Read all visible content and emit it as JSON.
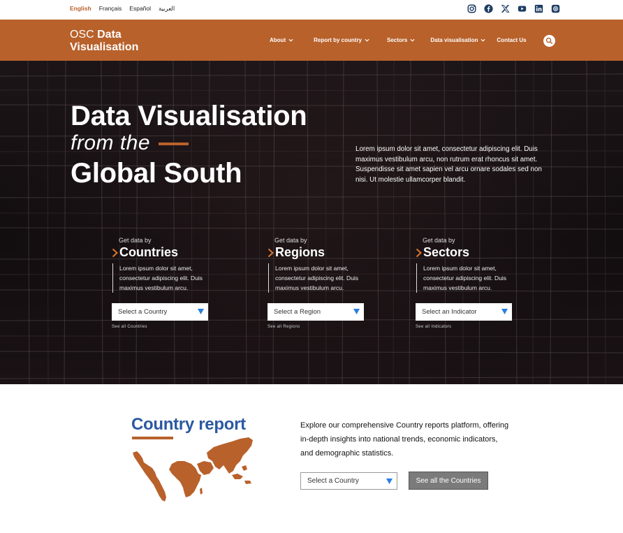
{
  "languages": [
    {
      "label": "English",
      "active": true
    },
    {
      "label": "Français",
      "active": false
    },
    {
      "label": "Español",
      "active": false
    },
    {
      "label": "العربية",
      "active": false
    }
  ],
  "socials": [
    "instagram-icon",
    "facebook-icon",
    "x-icon",
    "youtube-icon",
    "linkedin-icon",
    "threads-icon"
  ],
  "logo": {
    "light": "OSC ",
    "bold1": "Data",
    "bold2": "Visualisation"
  },
  "nav": {
    "about": "About",
    "report_by_country": "Report by country",
    "sectors": "Sectors",
    "data_visualisation": "Data visualisation",
    "contact": "Contact Us"
  },
  "hero": {
    "title_line1": "Data Visualisation",
    "title_line2": "from the",
    "title_line3": "Global South",
    "description": "Lorem ipsum dolor sit amet, consectetur adipiscing elit. Duis maximus vestibulum arcu, non rutrum erat rhoncus sit amet. Suspendisse sit amet sapien vel arcu ornare sodales sed non nisi. Ut molestie ullamcorper blandit."
  },
  "columns": [
    {
      "pre": "Get data by",
      "title": "Countries",
      "desc": "Lorem ipsum dolor sit amet, consectetur adipiscing elit. Duis maximus vestibulum arcu.",
      "select": "Select a Country",
      "see_all": "See all Countries"
    },
    {
      "pre": "Get data by",
      "title": "Regions",
      "desc": "Lorem ipsum dolor sit amet, consectetur adipiscing elit. Duis maximus vestibulum arcu.",
      "select": "Select a Region",
      "see_all": "See all Regions"
    },
    {
      "pre": "Get data by",
      "title": "Sectors",
      "desc": "Lorem ipsum dolor sit amet, consectetur adipiscing elit. Duis maximus vestibulum arcu.",
      "select": "Select an Indicator",
      "see_all": "See all Indicators"
    }
  ],
  "country_report": {
    "title": "Country report",
    "description": "Explore our comprehensive Country reports platform, offering in-depth insights into national trends, economic indicators, and demographic statistics.",
    "select": "Select a Country",
    "button": "See all the Countries"
  },
  "colors": {
    "brand": "#b8612b",
    "title_blue": "#2b59a0",
    "select_arrow": "#2a7de1",
    "hero_bg": "#140f11"
  }
}
